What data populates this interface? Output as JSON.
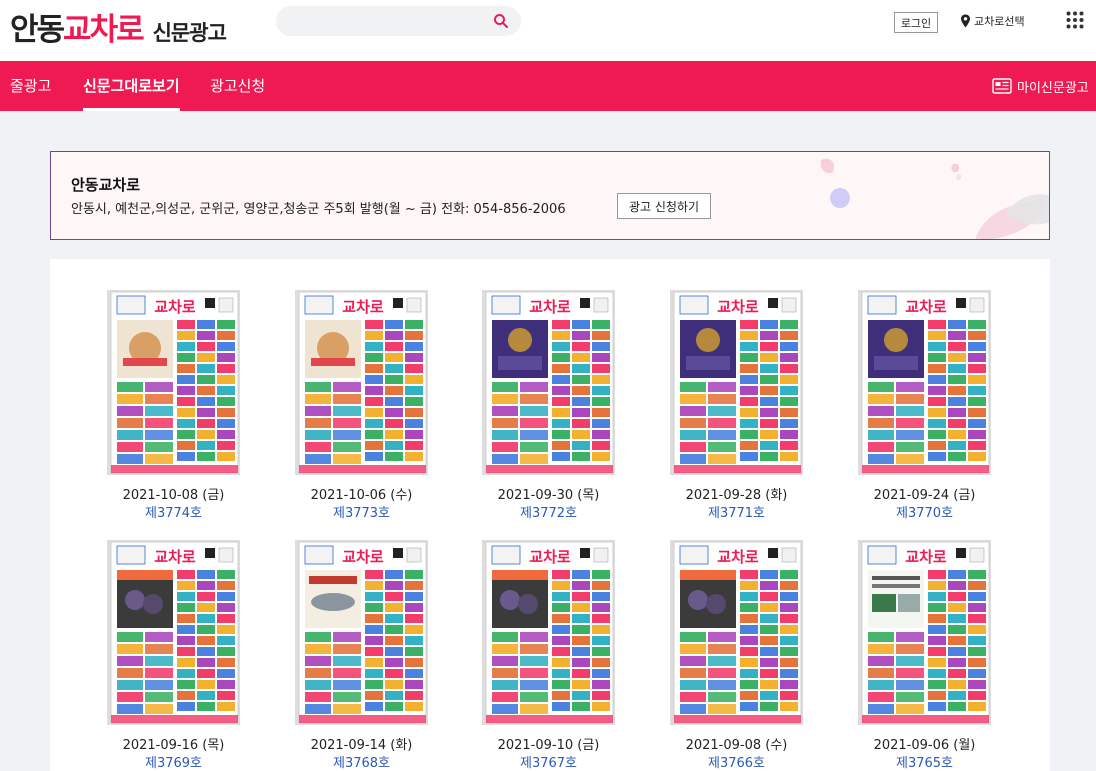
{
  "header": {
    "logo_main": "안동",
    "logo_accent": "교차로",
    "logo_sub": "신문광고",
    "search_placeholder": "",
    "login_label": "로그인",
    "region_label": "교차로선택"
  },
  "nav": {
    "items": [
      {
        "label": "줄광고",
        "active": false
      },
      {
        "label": "신문그대로보기",
        "active": true
      },
      {
        "label": "광고신청",
        "active": false
      }
    ],
    "my_ad_label": "마이신문광고"
  },
  "banner": {
    "title": "안동교차로",
    "description": "안동시, 예천군,의성군, 군위군, 영양군,청송군 주5회 발행(월 ~ 금) 전화: 054-856-2006",
    "apply_label": "광고 신청하기"
  },
  "issues": [
    {
      "date": "2021-10-08 (금)",
      "number": "제3774호",
      "style": "food"
    },
    {
      "date": "2021-10-06 (수)",
      "number": "제3773호",
      "style": "food"
    },
    {
      "date": "2021-09-30 (목)",
      "number": "제3772호",
      "style": "purple"
    },
    {
      "date": "2021-09-28 (화)",
      "number": "제3771호",
      "style": "purple"
    },
    {
      "date": "2021-09-24 (금)",
      "number": "제3770호",
      "style": "purple"
    },
    {
      "date": "2021-09-16 (목)",
      "number": "제3769호",
      "style": "fruit"
    },
    {
      "date": "2021-09-14 (화)",
      "number": "제3768호",
      "style": "fish"
    },
    {
      "date": "2021-09-10 (금)",
      "number": "제3767호",
      "style": "fruit"
    },
    {
      "date": "2021-09-08 (수)",
      "number": "제3766호",
      "style": "fruit"
    },
    {
      "date": "2021-09-06 (월)",
      "number": "제3765호",
      "style": "notice"
    }
  ],
  "colors": {
    "brand": "#ef1a52",
    "link": "#2a59b6",
    "banner_border": "#6b4a93",
    "panel_bg": "#f1f2f6"
  },
  "icons": {
    "search": "search-icon",
    "region": "map-pin-icon",
    "apps": "grid-icon",
    "my_ad": "newspaper-icon"
  }
}
